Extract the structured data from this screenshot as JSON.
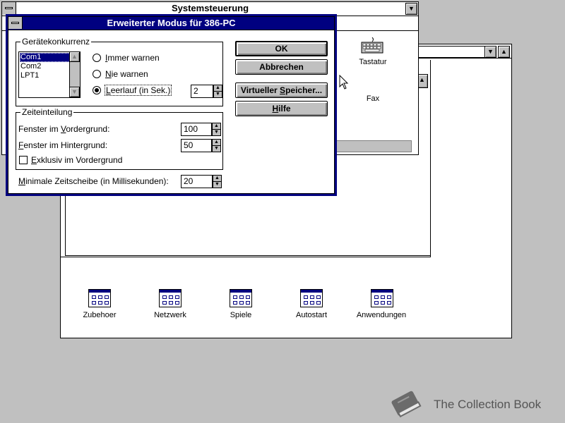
{
  "control_panel": {
    "title": "Systemsteuerung"
  },
  "control_panel_icons": [
    {
      "label": "Tastatur",
      "icon": "keyboard-icon"
    },
    {
      "label": "Fax",
      "icon": "fax-icon"
    }
  ],
  "program_groups": [
    {
      "label": "Zubehoer",
      "icon": "program-group-icon"
    },
    {
      "label": "Netzwerk",
      "icon": "program-group-icon"
    },
    {
      "label": "Spiele",
      "icon": "program-group-icon"
    },
    {
      "label": "Autostart",
      "icon": "program-group-icon"
    },
    {
      "label": "Anwendungen",
      "icon": "program-group-icon"
    }
  ],
  "dialog": {
    "title": "Erweiterter Modus für 386-PC",
    "device_contention": {
      "label": "Gerätekonkurrenz",
      "ports": [
        "Com1",
        "Com2",
        "LPT1"
      ],
      "selected_port": "Com1",
      "options": [
        "Immer warnen",
        "Nie warnen",
        "Leerlauf (in Sek.)"
      ],
      "selected_option": "Leerlauf (in Sek.)",
      "idle_seconds": "2"
    },
    "scheduling": {
      "label": "Zeiteinteilung",
      "foreground_label": "Fenster im Vordergrund:",
      "foreground_value": "100",
      "background_label": "Fenster im Hintergrund:",
      "background_value": "50",
      "exclusive_label": "Exklusiv im Vordergrund",
      "exclusive_checked": false
    },
    "min_timeslice_label": "Minimale Zeitscheibe (in Millisekunden):",
    "min_timeslice_value": "20",
    "buttons": {
      "ok": "OK",
      "cancel": "Abbrechen",
      "virtual_memory": "Virtueller Speicher...",
      "help": "Hilfe"
    }
  },
  "watermark": {
    "text": "The Collection Book",
    "icon": "book-icon"
  },
  "colors": {
    "desktop": "#c0c0c0",
    "active_title": "#000080",
    "window": "#ffffff"
  }
}
